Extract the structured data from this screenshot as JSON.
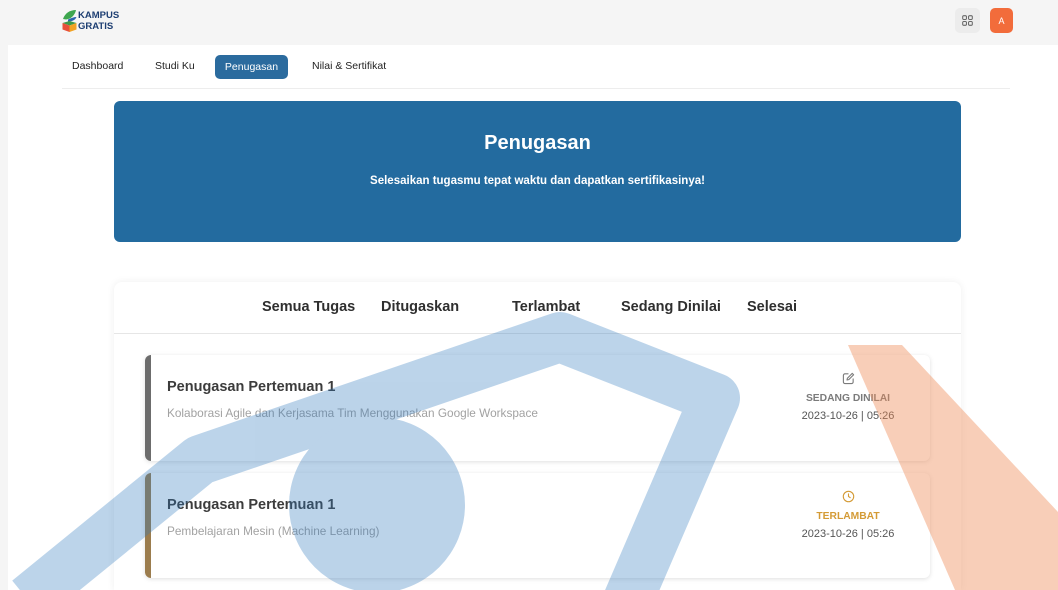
{
  "header": {
    "logo": {
      "line1": "KAMPUS",
      "line2": "GRATIS",
      "icon": "kampus-gratis-logo-icon"
    },
    "apps_button_icon": "grid-icon",
    "avatar": {
      "initial": "A",
      "color": "#f26c3b"
    }
  },
  "nav": {
    "items": [
      {
        "label": "Dashboard"
      },
      {
        "label": "Studi Ku"
      },
      {
        "label": "Penugasan",
        "active": true
      },
      {
        "label": "Nilai & Sertifikat"
      }
    ],
    "active_color": "#2b6b9e"
  },
  "banner": {
    "title": "Penugasan",
    "subtitle": "Selesaikan tugasmu tepat waktu dan dapatkan sertifikasinya!",
    "color": "#236b9f"
  },
  "tabs": [
    {
      "label": "Semua Tugas"
    },
    {
      "label": "Ditugaskan"
    },
    {
      "label": "Terlambat"
    },
    {
      "label": "Sedang Dinilai"
    },
    {
      "label": "Selesai"
    }
  ],
  "assignments": [
    {
      "title": "Penugasan Pertemuan 1",
      "course": "Kolaborasi Agile dan Kerjasama Tim Menggunakan Google Workspace",
      "status": "SEDANG DINILAI",
      "status_icon": "edit-icon",
      "datetime": "2023-10-26 | 05:26",
      "status_color": "#7b7b7b",
      "accent_color": "#6c6c6c"
    },
    {
      "title": "Penugasan Pertemuan 1",
      "course": "Pembelajaran Mesin (Machine Learning)",
      "status": "TERLAMBAT",
      "status_icon": "clock-icon",
      "datetime": "2023-10-26 | 05:26",
      "status_color": "#d49b36",
      "accent_color": "#9b7c4d"
    }
  ],
  "watermark": {
    "icon": "graduation-cap-watermark",
    "blue": "#2f78bd",
    "peach": "#ee8a56"
  }
}
